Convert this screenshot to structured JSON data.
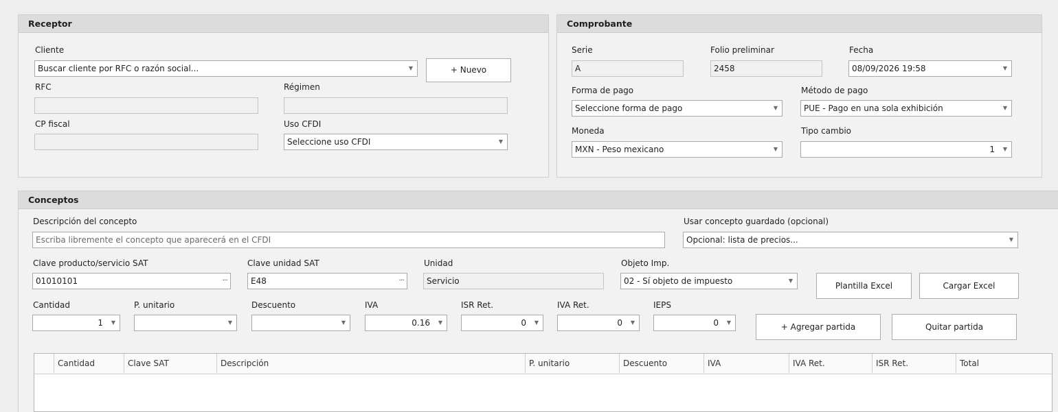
{
  "receptor": {
    "title": "Receptor",
    "cliente_label": "Cliente",
    "cliente_placeholder": "Buscar cliente por RFC o razón social...",
    "nuevo_button": "+ Nuevo",
    "rfc_label": "RFC",
    "regimen_label": "Régimen",
    "cp_label": "CP fiscal",
    "uso_cfdi_label": "Uso CFDI",
    "uso_cfdi_value": "Seleccione uso CFDI"
  },
  "comprobante": {
    "title": "Comprobante",
    "serie_label": "Serie",
    "serie_value": "A",
    "folio_label": "Folio preliminar",
    "folio_value": "2458",
    "fecha_label": "Fecha",
    "fecha_value": "08/09/2026 19:58",
    "forma_pago_label": "Forma de pago",
    "forma_pago_value": "Seleccione forma de pago",
    "metodo_pago_label": "Método de pago",
    "metodo_pago_value": "PUE - Pago en una sola exhibición",
    "moneda_label": "Moneda",
    "moneda_value": "MXN - Peso mexicano",
    "tipo_cambio_label": "Tipo cambio",
    "tipo_cambio_value": "1"
  },
  "conceptos": {
    "title": "Conceptos",
    "descripcion_label": "Descripción del concepto",
    "descripcion_placeholder": "Escriba libremente el concepto que aparecerá en el CFDI",
    "guardado_label": "Usar concepto guardado (opcional)",
    "guardado_value": "Opcional: lista de precios...",
    "clave_prod_label": "Clave producto/servicio SAT",
    "clave_prod_value": "01010101",
    "clave_unidad_label": "Clave unidad SAT",
    "clave_unidad_value": "E48",
    "unidad_label": "Unidad",
    "unidad_value": "Servicio",
    "objeto_label": "Objeto Imp.",
    "objeto_value": "02 - Sí objeto de impuesto",
    "plantilla_button": "Plantilla Excel",
    "cargar_button": "Cargar Excel",
    "cantidad_label": "Cantidad",
    "cantidad_value": "1",
    "punitario_label": "P. unitario",
    "punitario_value": "",
    "descuento_label": "Descuento",
    "descuento_value": "",
    "iva_label": "IVA",
    "iva_value": "0.16",
    "isr_ret_label": "ISR Ret.",
    "isr_ret_value": "0",
    "iva_ret_label": "IVA Ret.",
    "iva_ret_value": "0",
    "ieps_label": "IEPS",
    "ieps_value": "0",
    "agregar_button": "+ Agregar partida",
    "quitar_button": "Quitar partida"
  },
  "grid": {
    "columns": [
      "Cantidad",
      "Clave SAT",
      "Descripción",
      "P. unitario",
      "Descuento",
      "IVA",
      "IVA Ret.",
      "ISR Ret.",
      "Total"
    ]
  },
  "icons": {
    "dropdown": "chevron-down-icon",
    "lookup": "ellipsis-icon"
  }
}
